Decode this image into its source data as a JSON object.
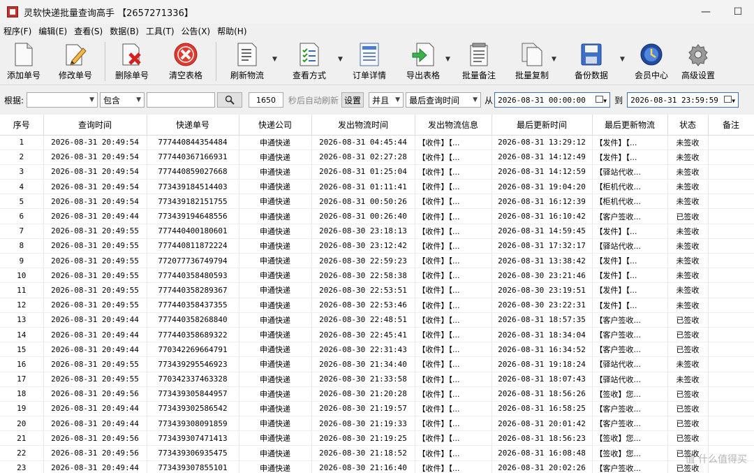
{
  "window": {
    "title": "灵软快递批量查询高手 【2657271336】",
    "min": "—",
    "max": "☐"
  },
  "menu": [
    "程序(F)",
    "编辑(E)",
    "查看(S)",
    "数据(B)",
    "工具(T)",
    "公告(X)",
    "帮助(H)"
  ],
  "toolbar": {
    "add": "添加单号",
    "edit": "修改单号",
    "delete": "删除单号",
    "clear": "清空表格",
    "refresh": "刷新物流",
    "view_mode": "查看方式",
    "order_detail": "订单详情",
    "export": "导出表格",
    "batch_note": "批量备注",
    "batch_copy": "批量复制",
    "backup": "备份数据",
    "member": "会员中心",
    "settings": "高级设置"
  },
  "filter": {
    "label_by": "根据:",
    "field_value": "",
    "match_value": "包含",
    "search_text": "",
    "search_icon": "magnifier",
    "interval": "1650",
    "auto_refresh": "秒后自动刷新",
    "setup": "设置",
    "logic": "并且",
    "time_field": "最后查询时间",
    "from": "从",
    "start": "2026-08-31 00:00:00",
    "to": "到",
    "end": "2026-08-31 23:59:59"
  },
  "table": {
    "headers": [
      "序号",
      "查询时间",
      "快递单号",
      "快递公司",
      "发出物流时间",
      "发出物流信息",
      "最后更新时间",
      "最后更新物流",
      "状态",
      "备注"
    ],
    "rows": [
      [
        "1",
        "2026-08-31 20:49:54",
        "777440844354484",
        "申通快递",
        "2026-08-31 04:45:44",
        "【收件】【...",
        "2026-08-31 13:29:12",
        "【发件】【...",
        "未签收",
        ""
      ],
      [
        "2",
        "2026-08-31 20:49:54",
        "777440367166931",
        "申通快递",
        "2026-08-31 02:27:28",
        "【收件】【...",
        "2026-08-31 14:12:49",
        "【发件】【...",
        "未签收",
        ""
      ],
      [
        "3",
        "2026-08-31 20:49:54",
        "777440859027668",
        "申通快递",
        "2026-08-31 01:25:04",
        "【收件】【...",
        "2026-08-31 14:12:59",
        "【驿站代收...",
        "未签收",
        ""
      ],
      [
        "4",
        "2026-08-31 20:49:54",
        "773439184514403",
        "申通快递",
        "2026-08-31 01:11:41",
        "【收件】【...",
        "2026-08-31 19:04:20",
        "【柜机代收...",
        "未签收",
        ""
      ],
      [
        "5",
        "2026-08-31 20:49:54",
        "773439182151755",
        "申通快递",
        "2026-08-31 00:50:26",
        "【收件】【...",
        "2026-08-31 16:12:39",
        "【柜机代收...",
        "未签收",
        ""
      ],
      [
        "6",
        "2026-08-31 20:49:44",
        "773439194648556",
        "申通快递",
        "2026-08-31 00:26:40",
        "【收件】【...",
        "2026-08-31 16:10:42",
        "【客户签收...",
        "已签收",
        ""
      ],
      [
        "7",
        "2026-08-31 20:49:55",
        "777440400180601",
        "申通快递",
        "2026-08-30 23:18:13",
        "【收件】【...",
        "2026-08-31 14:59:45",
        "【发件】【...",
        "未签收",
        ""
      ],
      [
        "8",
        "2026-08-31 20:49:55",
        "777440811872224",
        "申通快递",
        "2026-08-30 23:12:42",
        "【收件】【...",
        "2026-08-31 17:32:17",
        "【驿站代收...",
        "未签收",
        ""
      ],
      [
        "9",
        "2026-08-31 20:49:55",
        "772077736749794",
        "申通快递",
        "2026-08-30 22:59:23",
        "【收件】【...",
        "2026-08-31 13:38:42",
        "【发件】【...",
        "未签收",
        ""
      ],
      [
        "10",
        "2026-08-31 20:49:55",
        "777440358480593",
        "申通快递",
        "2026-08-30 22:58:38",
        "【收件】【...",
        "2026-08-30 23:21:46",
        "【发件】【...",
        "未签收",
        ""
      ],
      [
        "11",
        "2026-08-31 20:49:55",
        "777440358289367",
        "申通快递",
        "2026-08-30 22:53:51",
        "【收件】【...",
        "2026-08-30 23:19:51",
        "【发件】【...",
        "未签收",
        ""
      ],
      [
        "12",
        "2026-08-31 20:49:55",
        "777440358437355",
        "申通快递",
        "2026-08-30 22:53:46",
        "【收件】【...",
        "2026-08-30 23:22:31",
        "【发件】【...",
        "未签收",
        ""
      ],
      [
        "13",
        "2026-08-31 20:49:44",
        "777440358268840",
        "申通快递",
        "2026-08-30 22:48:51",
        "【收件】【...",
        "2026-08-31 18:57:35",
        "【客户签收...",
        "已签收",
        ""
      ],
      [
        "14",
        "2026-08-31 20:49:44",
        "777440358689322",
        "申通快递",
        "2026-08-30 22:45:41",
        "【收件】【...",
        "2026-08-31 18:34:04",
        "【客户签收...",
        "已签收",
        ""
      ],
      [
        "15",
        "2026-08-31 20:49:44",
        "770342269664791",
        "申通快递",
        "2026-08-30 22:31:43",
        "【收件】【...",
        "2026-08-31 16:34:52",
        "【客户签收...",
        "已签收",
        ""
      ],
      [
        "16",
        "2026-08-31 20:49:55",
        "773439295546923",
        "申通快递",
        "2026-08-30 21:34:40",
        "【收件】【...",
        "2026-08-31 19:18:24",
        "【驿站代收...",
        "未签收",
        ""
      ],
      [
        "17",
        "2026-08-31 20:49:55",
        "770342337463328",
        "申通快递",
        "2026-08-30 21:33:58",
        "【收件】【...",
        "2026-08-31 18:07:43",
        "【驿站代收...",
        "未签收",
        ""
      ],
      [
        "18",
        "2026-08-31 20:49:56",
        "773439305844957",
        "申通快递",
        "2026-08-30 21:20:28",
        "【收件】【...",
        "2026-08-31 18:56:26",
        "【签收】您...",
        "已签收",
        ""
      ],
      [
        "19",
        "2026-08-31 20:49:44",
        "773439302586542",
        "申通快递",
        "2026-08-30 21:19:57",
        "【收件】【...",
        "2026-08-31 16:58:25",
        "【客户签收...",
        "已签收",
        ""
      ],
      [
        "20",
        "2026-08-31 20:49:44",
        "773439308091859",
        "申通快递",
        "2026-08-30 21:19:33",
        "【收件】【...",
        "2026-08-31 20:01:42",
        "【客户签收...",
        "已签收",
        ""
      ],
      [
        "21",
        "2026-08-31 20:49:56",
        "773439307471413",
        "申通快递",
        "2026-08-30 21:19:25",
        "【收件】【...",
        "2026-08-31 18:56:23",
        "【签收】您...",
        "已签收",
        ""
      ],
      [
        "22",
        "2026-08-31 20:49:56",
        "773439306935475",
        "申通快递",
        "2026-08-30 21:18:52",
        "【收件】【...",
        "2026-08-31 16:08:48",
        "【签收】您...",
        "已签收",
        ""
      ],
      [
        "23",
        "2026-08-31 20:49:44",
        "773439307855101",
        "申通快递",
        "2026-08-30 21:16:40",
        "【收件】【...",
        "2026-08-31 20:02:26",
        "【客户签收...",
        "已签收",
        ""
      ]
    ]
  },
  "watermark": "值 什么值得买"
}
